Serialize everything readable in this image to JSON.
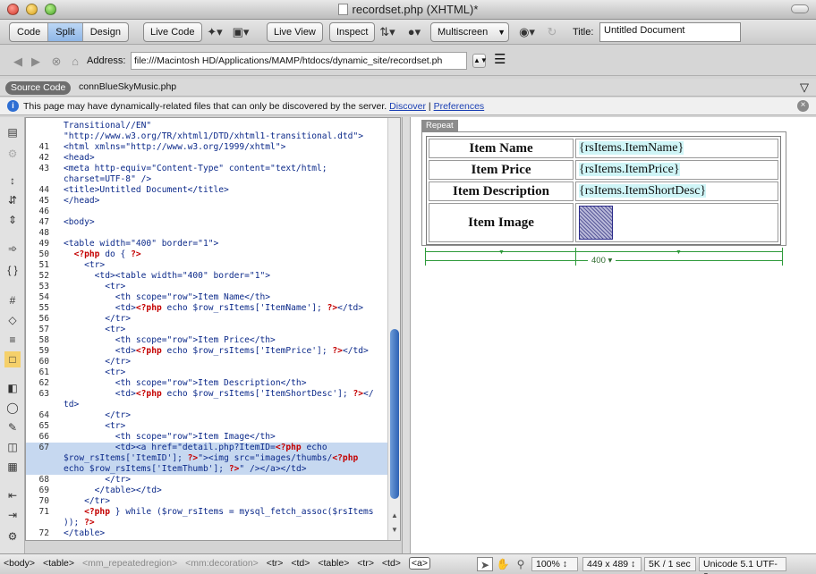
{
  "window": {
    "title": "recordset.php (XHTML)*"
  },
  "toolbar": {
    "view_buttons": [
      "Code",
      "Split",
      "Design"
    ],
    "active_view": "Split",
    "live_code": "Live Code",
    "live_view": "Live View",
    "inspect": "Inspect",
    "multiscreen": "Multiscreen",
    "title_label": "Title:",
    "title_value": "Untitled Document"
  },
  "address": {
    "label": "Address:",
    "value": "file:///Macintosh HD/Applications/MAMP/htdocs/dynamic_site/recordset.ph"
  },
  "related": {
    "source_code": "Source Code",
    "file": "connBlueSkyMusic.php"
  },
  "info": {
    "message": "This page may have dynamically-related files that can only be discovered by the server.",
    "discover": "Discover",
    "separator": "|",
    "preferences": "Preferences"
  },
  "code": {
    "lines": [
      {
        "n": "",
        "text": "Transitional//EN\""
      },
      {
        "n": "",
        "text": "\"http://www.w3.org/TR/xhtml1/DTD/xhtml1-transitional.dtd\">"
      },
      {
        "n": "41",
        "text": "<html xmlns=\"http://www.w3.org/1999/xhtml\">"
      },
      {
        "n": "42",
        "text": "<head>"
      },
      {
        "n": "43",
        "text": "<meta http-equiv=\"Content-Type\" content=\"text/html;"
      },
      {
        "n": "",
        "text": "charset=UTF-8\" />"
      },
      {
        "n": "44",
        "text": "<title>Untitled Document</title>"
      },
      {
        "n": "45",
        "text": "</head>"
      },
      {
        "n": "46",
        "text": ""
      },
      {
        "n": "47",
        "text": "<body>"
      },
      {
        "n": "48",
        "text": ""
      },
      {
        "n": "49",
        "text": "<table width=\"400\" border=\"1\">"
      },
      {
        "n": "50",
        "text": "  <?php do { ?>"
      },
      {
        "n": "51",
        "text": "    <tr>"
      },
      {
        "n": "52",
        "text": "      <td><table width=\"400\" border=\"1\">"
      },
      {
        "n": "53",
        "text": "        <tr>"
      },
      {
        "n": "54",
        "text": "          <th scope=\"row\">Item Name</th>"
      },
      {
        "n": "55",
        "text": "          <td><?php echo $row_rsItems['ItemName']; ?></td>"
      },
      {
        "n": "56",
        "text": "        </tr>"
      },
      {
        "n": "57",
        "text": "        <tr>"
      },
      {
        "n": "58",
        "text": "          <th scope=\"row\">Item Price</th>"
      },
      {
        "n": "59",
        "text": "          <td><?php echo $row_rsItems['ItemPrice']; ?></td>"
      },
      {
        "n": "60",
        "text": "        </tr>"
      },
      {
        "n": "61",
        "text": "        <tr>"
      },
      {
        "n": "62",
        "text": "          <th scope=\"row\">Item Description</th>"
      },
      {
        "n": "63",
        "text": "          <td><?php echo $row_rsItems['ItemShortDesc']; ?></"
      },
      {
        "n": "",
        "text": "td>"
      },
      {
        "n": "64",
        "text": "        </tr>"
      },
      {
        "n": "65",
        "text": "        <tr>"
      },
      {
        "n": "66",
        "text": "          <th scope=\"row\">Item Image</th>"
      },
      {
        "n": "67",
        "text": "          <td><a href=\"detail.php?ItemID=<?php echo",
        "hl": true
      },
      {
        "n": "",
        "text": "$row_rsItems['ItemID']; ?>\"><img src=\"images/thumbs/<?php",
        "hl": true
      },
      {
        "n": "",
        "text": "echo $row_rsItems['ItemThumb']; ?>\" /></a></td>",
        "hl": true
      },
      {
        "n": "68",
        "text": "        </tr>"
      },
      {
        "n": "69",
        "text": "      </table></td>"
      },
      {
        "n": "70",
        "text": "    </tr>"
      },
      {
        "n": "71",
        "text": "    <?php } while ($row_rsItems = mysql_fetch_assoc($rsItems"
      },
      {
        "n": "",
        "text": ")); ?>"
      },
      {
        "n": "72",
        "text": "</table>"
      }
    ]
  },
  "design": {
    "repeat_label": "Repeat",
    "rows": [
      {
        "label": "Item Name",
        "value": "{rsItems.ItemName}"
      },
      {
        "label": "Item Price",
        "value": "{rsItems.ItemPrice}"
      },
      {
        "label": "Item Description",
        "value": "{rsItems.ItemShortDesc}"
      },
      {
        "label": "Item Image",
        "value": ""
      }
    ],
    "width_label": "400"
  },
  "status": {
    "tags": [
      "<body>",
      "<table>",
      "<mm_repeatedregion>",
      "<mm:decoration>",
      "<tr>",
      "<td>",
      "<table>",
      "<tr>",
      "<td>",
      "<a>"
    ],
    "zoom": "100%",
    "dimensions": "449 x 489",
    "download": "5K / 1 sec",
    "encoding": "Unicode 5.1 UTF-8"
  }
}
